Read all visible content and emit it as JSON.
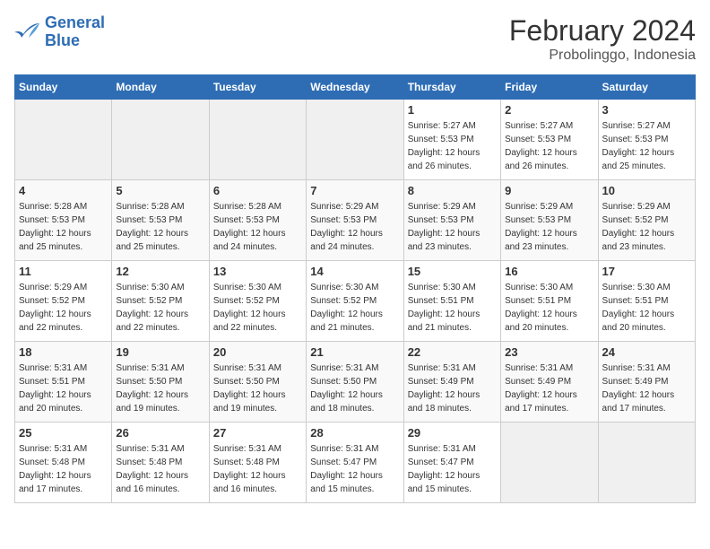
{
  "logo": {
    "line1": "General",
    "line2": "Blue"
  },
  "title": "February 2024",
  "subtitle": "Probolinggo, Indonesia",
  "days_of_week": [
    "Sunday",
    "Monday",
    "Tuesday",
    "Wednesday",
    "Thursday",
    "Friday",
    "Saturday"
  ],
  "weeks": [
    [
      {
        "day": "",
        "info": ""
      },
      {
        "day": "",
        "info": ""
      },
      {
        "day": "",
        "info": ""
      },
      {
        "day": "",
        "info": ""
      },
      {
        "day": "1",
        "info": "Sunrise: 5:27 AM\nSunset: 5:53 PM\nDaylight: 12 hours\nand 26 minutes."
      },
      {
        "day": "2",
        "info": "Sunrise: 5:27 AM\nSunset: 5:53 PM\nDaylight: 12 hours\nand 26 minutes."
      },
      {
        "day": "3",
        "info": "Sunrise: 5:27 AM\nSunset: 5:53 PM\nDaylight: 12 hours\nand 25 minutes."
      }
    ],
    [
      {
        "day": "4",
        "info": "Sunrise: 5:28 AM\nSunset: 5:53 PM\nDaylight: 12 hours\nand 25 minutes."
      },
      {
        "day": "5",
        "info": "Sunrise: 5:28 AM\nSunset: 5:53 PM\nDaylight: 12 hours\nand 25 minutes."
      },
      {
        "day": "6",
        "info": "Sunrise: 5:28 AM\nSunset: 5:53 PM\nDaylight: 12 hours\nand 24 minutes."
      },
      {
        "day": "7",
        "info": "Sunrise: 5:29 AM\nSunset: 5:53 PM\nDaylight: 12 hours\nand 24 minutes."
      },
      {
        "day": "8",
        "info": "Sunrise: 5:29 AM\nSunset: 5:53 PM\nDaylight: 12 hours\nand 23 minutes."
      },
      {
        "day": "9",
        "info": "Sunrise: 5:29 AM\nSunset: 5:53 PM\nDaylight: 12 hours\nand 23 minutes."
      },
      {
        "day": "10",
        "info": "Sunrise: 5:29 AM\nSunset: 5:52 PM\nDaylight: 12 hours\nand 23 minutes."
      }
    ],
    [
      {
        "day": "11",
        "info": "Sunrise: 5:29 AM\nSunset: 5:52 PM\nDaylight: 12 hours\nand 22 minutes."
      },
      {
        "day": "12",
        "info": "Sunrise: 5:30 AM\nSunset: 5:52 PM\nDaylight: 12 hours\nand 22 minutes."
      },
      {
        "day": "13",
        "info": "Sunrise: 5:30 AM\nSunset: 5:52 PM\nDaylight: 12 hours\nand 22 minutes."
      },
      {
        "day": "14",
        "info": "Sunrise: 5:30 AM\nSunset: 5:52 PM\nDaylight: 12 hours\nand 21 minutes."
      },
      {
        "day": "15",
        "info": "Sunrise: 5:30 AM\nSunset: 5:51 PM\nDaylight: 12 hours\nand 21 minutes."
      },
      {
        "day": "16",
        "info": "Sunrise: 5:30 AM\nSunset: 5:51 PM\nDaylight: 12 hours\nand 20 minutes."
      },
      {
        "day": "17",
        "info": "Sunrise: 5:30 AM\nSunset: 5:51 PM\nDaylight: 12 hours\nand 20 minutes."
      }
    ],
    [
      {
        "day": "18",
        "info": "Sunrise: 5:31 AM\nSunset: 5:51 PM\nDaylight: 12 hours\nand 20 minutes."
      },
      {
        "day": "19",
        "info": "Sunrise: 5:31 AM\nSunset: 5:50 PM\nDaylight: 12 hours\nand 19 minutes."
      },
      {
        "day": "20",
        "info": "Sunrise: 5:31 AM\nSunset: 5:50 PM\nDaylight: 12 hours\nand 19 minutes."
      },
      {
        "day": "21",
        "info": "Sunrise: 5:31 AM\nSunset: 5:50 PM\nDaylight: 12 hours\nand 18 minutes."
      },
      {
        "day": "22",
        "info": "Sunrise: 5:31 AM\nSunset: 5:49 PM\nDaylight: 12 hours\nand 18 minutes."
      },
      {
        "day": "23",
        "info": "Sunrise: 5:31 AM\nSunset: 5:49 PM\nDaylight: 12 hours\nand 17 minutes."
      },
      {
        "day": "24",
        "info": "Sunrise: 5:31 AM\nSunset: 5:49 PM\nDaylight: 12 hours\nand 17 minutes."
      }
    ],
    [
      {
        "day": "25",
        "info": "Sunrise: 5:31 AM\nSunset: 5:48 PM\nDaylight: 12 hours\nand 17 minutes."
      },
      {
        "day": "26",
        "info": "Sunrise: 5:31 AM\nSunset: 5:48 PM\nDaylight: 12 hours\nand 16 minutes."
      },
      {
        "day": "27",
        "info": "Sunrise: 5:31 AM\nSunset: 5:48 PM\nDaylight: 12 hours\nand 16 minutes."
      },
      {
        "day": "28",
        "info": "Sunrise: 5:31 AM\nSunset: 5:47 PM\nDaylight: 12 hours\nand 15 minutes."
      },
      {
        "day": "29",
        "info": "Sunrise: 5:31 AM\nSunset: 5:47 PM\nDaylight: 12 hours\nand 15 minutes."
      },
      {
        "day": "",
        "info": ""
      },
      {
        "day": "",
        "info": ""
      }
    ]
  ]
}
